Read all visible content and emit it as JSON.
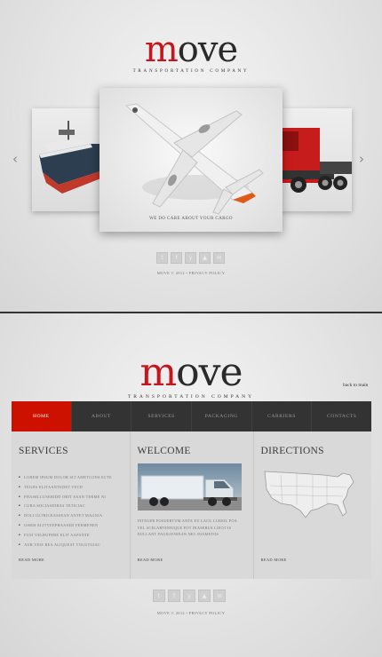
{
  "top": {
    "logo": {
      "m": "m",
      "rest": "ove",
      "sub": "Transportation Company"
    },
    "slider": {
      "caption": "WE DO CARE ABOUT YOUR CARGO",
      "prev_icon": "chevron-left-icon",
      "next_icon": "chevron-right-icon",
      "prev_glyph": "‹",
      "next_glyph": "›"
    },
    "social": [
      "t",
      "f",
      "y",
      "▲",
      "✉"
    ],
    "footer": "MOVE © 2012 • PRIVACY POLICY"
  },
  "bottom": {
    "logo": {
      "m": "m",
      "rest": "ove",
      "sub": "Transportation Company"
    },
    "back_link": "back to main",
    "nav": [
      "HOME",
      "ABOUT",
      "SERVICES",
      "PACKAGING",
      "CARRIERS",
      "CONTACTS"
    ],
    "services": {
      "title": "SERVICES",
      "items": [
        "LOREM IPSUM DOLOR SIT AMETCONS ECTE",
        "TEGIIS ELITAANTEDET VECD",
        "PHASELLUSERIDD OBIT SAAN TERME NI",
        "CURA SOCIASDIRAS TETICIAC",
        "DOLI ULTRICEASSEAN ANTET MAGNIA",
        "OSBIS ELITVEEPHAASED FERMENEN",
        "FUSI VELRUPERE ELIT AAFANTE",
        "AUR VEIS BEA ALIQUEAT VOLUTGIAC"
      ],
      "read_more": "READ MORE"
    },
    "welcome": {
      "title": "WELCOME",
      "text": "INTEGER POSUERTUM ANTE EU LACU LUREIL POA VEL SCELARTENEIQUE FOT DIASERUS LIEOT IS NULLANT FAGILIENIEAN NEC DIAMETOS",
      "read_more": "READ MORE"
    },
    "directions": {
      "title": "DIRECTIONS",
      "read_more": "READ MORE"
    },
    "social": [
      "t",
      "f",
      "y",
      "▲",
      "✉"
    ],
    "footer": "MOVE © 2012 • PRIVACY POLICY"
  },
  "colors": {
    "accent": "#cc1100",
    "nav_bg": "#333333",
    "logo_red": "#c4161c"
  }
}
